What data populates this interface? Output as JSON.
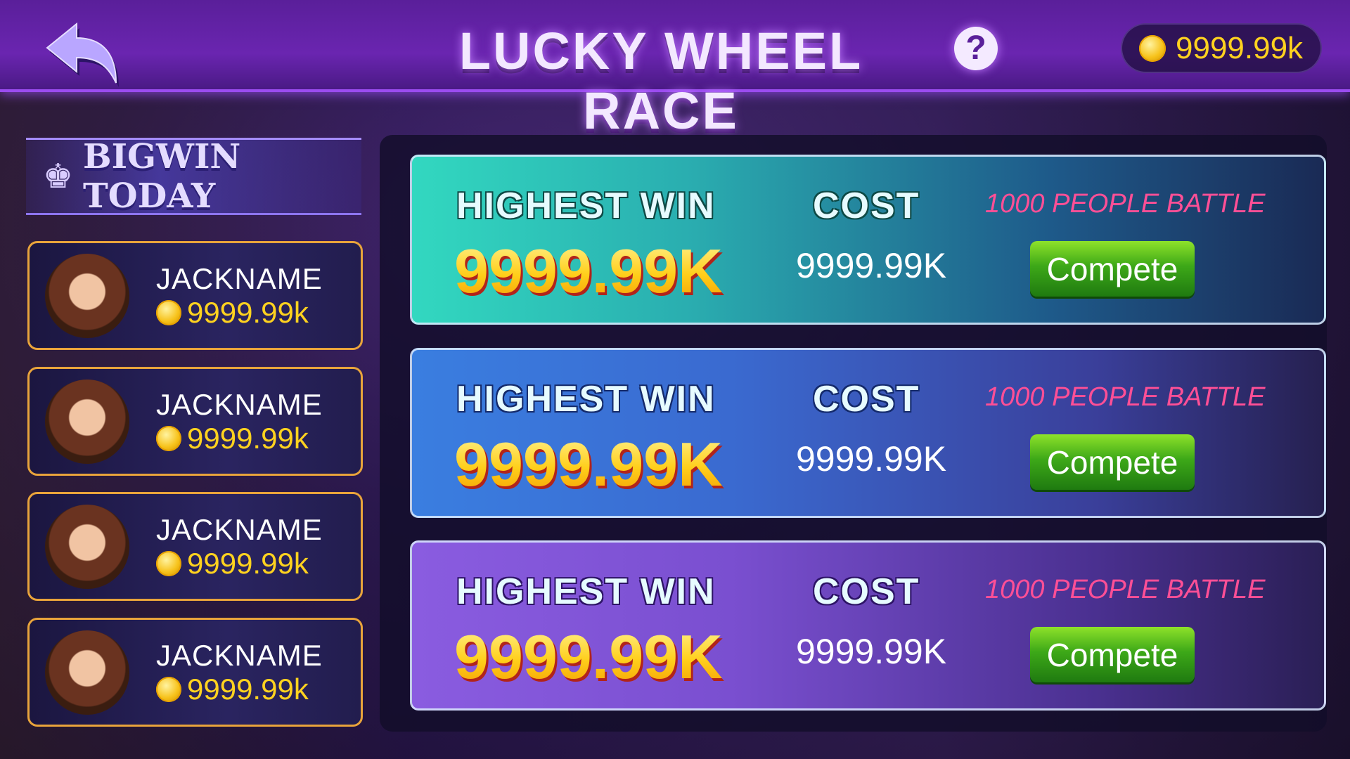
{
  "header": {
    "title": "LUCKY WHEEL RACE",
    "help": "?",
    "balance": "9999.99k"
  },
  "bigwin": {
    "title": "BIGWIN TODAY",
    "players": [
      {
        "name": "JACKNAME",
        "amount": "9999.99k"
      },
      {
        "name": "JACKNAME",
        "amount": "9999.99k"
      },
      {
        "name": "JACKNAME",
        "amount": "9999.99k"
      },
      {
        "name": "JACKNAME",
        "amount": "9999.99k"
      }
    ]
  },
  "races": [
    {
      "highest_label": "HIGHEST WIN",
      "highest_value": "9999.99K",
      "cost_label": "COST",
      "cost_value": "9999.99K",
      "battle": "1000 PEOPLE BATTLE",
      "button": "Compete"
    },
    {
      "highest_label": "HIGHEST WIN",
      "highest_value": "9999.99K",
      "cost_label": "COST",
      "cost_value": "9999.99K",
      "battle": "1000 PEOPLE BATTLE",
      "button": "Compete"
    },
    {
      "highest_label": "HIGHEST WIN",
      "highest_value": "9999.99K",
      "cost_label": "COST",
      "cost_value": "9999.99K",
      "battle": "1000 PEOPLE BATTLE",
      "button": "Compete"
    }
  ]
}
